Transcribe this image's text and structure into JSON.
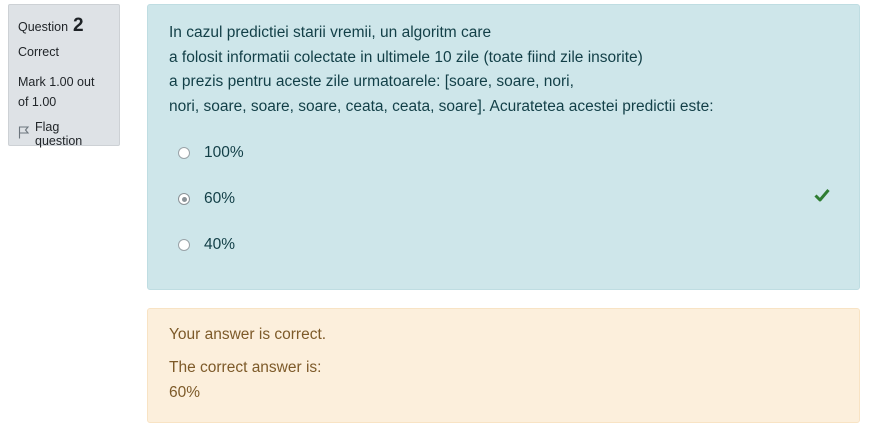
{
  "info": {
    "question_label": "Question",
    "question_number": "2",
    "state": "Correct",
    "grade_line1": "Mark 1.00 out",
    "grade_line2": "of 1.00",
    "flag_label": "Flag question"
  },
  "question": {
    "text_lines": [
      "In cazul predictiei starii vremii, un algoritm care",
      "a folosit informatii colectate in ultimele 10 zile (toate fiind zile insorite)",
      "a prezis pentru aceste zile urmatoarele: [soare, soare, nori,",
      "nori, soare, soare, soare, ceata, ceata, soare]. Acuratetea acestei predictii este:"
    ],
    "answers": [
      {
        "label": "100%",
        "selected": false
      },
      {
        "label": "60%",
        "selected": true
      },
      {
        "label": "40%",
        "selected": false
      }
    ],
    "correct_icon": "check-icon",
    "correct_color": "#2e7d32"
  },
  "feedback": {
    "general": "Your answer is correct.",
    "right_answer_label": "The correct answer is:",
    "right_answer_value": "60%"
  },
  "colors": {
    "question_bg": "#cee6ea",
    "feedback_bg": "#fcefdc",
    "info_bg": "#dee2e6"
  }
}
